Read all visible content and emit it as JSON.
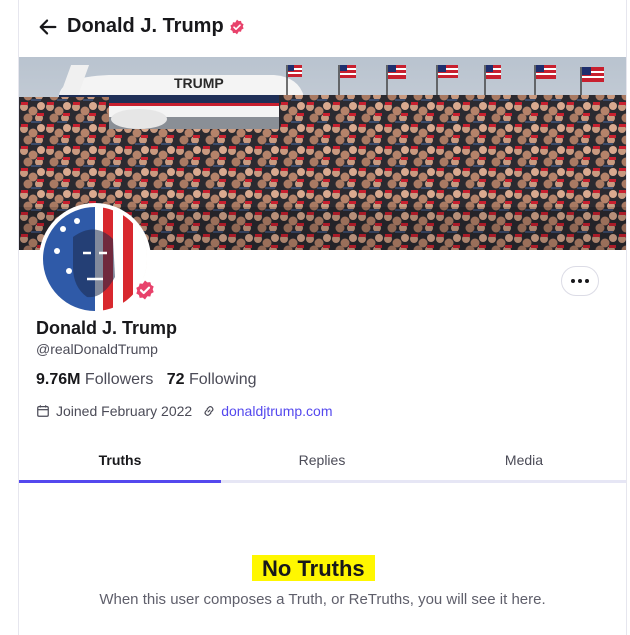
{
  "header": {
    "title": "Donald J. Trump",
    "back_icon": "arrow-left-icon",
    "verified_icon": "verified-badge-icon"
  },
  "banner": {
    "plane_text": "TRUMP",
    "description_icon": "rally-crowd-banner"
  },
  "profile": {
    "display_name": "Donald J. Trump",
    "handle": "@realDonaldTrump",
    "followers_count": "9.76M",
    "followers_label": "Followers",
    "following_count": "72",
    "following_label": "Following",
    "joined": "Joined February 2022",
    "website": "donaldjtrump.com"
  },
  "tabs": [
    {
      "label": "Truths",
      "active": true
    },
    {
      "label": "Replies",
      "active": false
    },
    {
      "label": "Media",
      "active": false
    }
  ],
  "empty_state": {
    "title": "No Truths",
    "subtitle": "When this user composes a Truth, or ReTruths, you will see it here."
  },
  "colors": {
    "accent": "#5448ee",
    "verified": "#e8426b",
    "highlight": "#fff700"
  }
}
